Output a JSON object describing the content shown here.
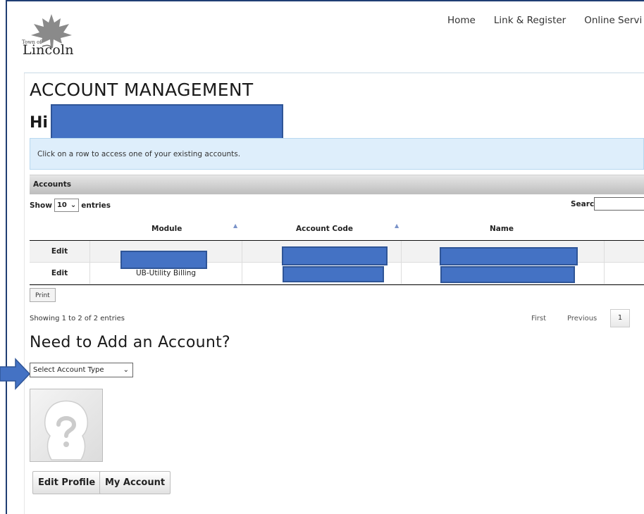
{
  "logo": {
    "small_text": "Town of",
    "big_text": "Lincoln"
  },
  "nav": {
    "items": [
      "Home",
      "Link & Register",
      "Online Servi"
    ]
  },
  "page": {
    "title": "ACCOUNT MANAGEMENT",
    "greeting": "Hi",
    "info": "Click on a row to access one of your existing accounts."
  },
  "accounts": {
    "section_title": "Accounts",
    "show_label": "Show",
    "entries_value": "10",
    "entries_label": "entries",
    "search_label": "Search:",
    "columns": [
      "Module",
      "Account Code",
      "Name"
    ],
    "rows": [
      {
        "action": "Edit",
        "module": ""
      },
      {
        "action": "Edit",
        "module": "UB-Utility Billing"
      }
    ],
    "print_label": "Print",
    "showing_text": "Showing 1 to 2 of 2 entries",
    "pager": {
      "first": "First",
      "previous": "Previous",
      "page": "1"
    }
  },
  "add_account": {
    "title": "Need to Add an Account?",
    "select_value": "Select Account Type"
  },
  "profile": {
    "edit_label": "Edit Profile",
    "my_account_label": "My Account"
  },
  "colors": {
    "redaction": "#4472c4",
    "info_bg": "#deeefb",
    "frame": "#1f3d73"
  }
}
